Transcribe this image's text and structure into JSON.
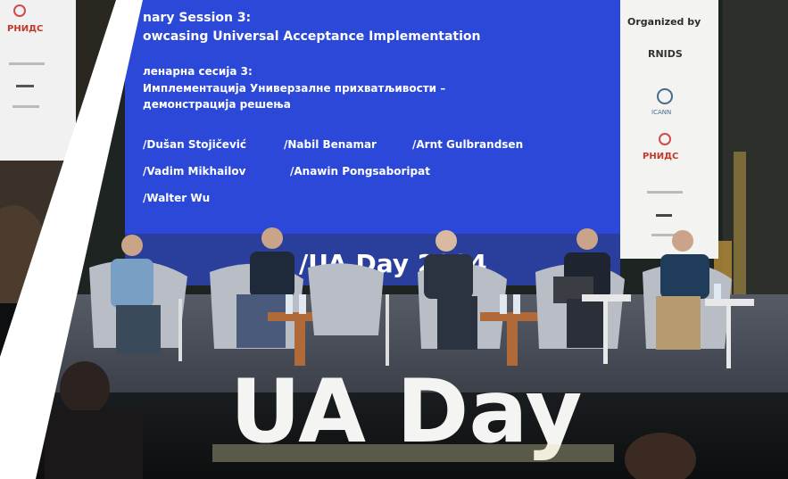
{
  "screen": {
    "headline_en": "nary Session 3:",
    "subtitle_en": "owcasing Universal Acceptance Implementation",
    "headline_sr": "ленарна сесија 3:",
    "subtitle_sr_1": "Имплементација Универзалне прихватљивости –",
    "subtitle_sr_2": "демонстрација решења",
    "speakers_row1": [
      "/Dušan Stojičević",
      "/Nabil Benamar",
      "/Arnt Gulbrandsen"
    ],
    "speakers_row2": [
      "/Vadim Mikhailov",
      "/Anawin Pongsaboripat"
    ],
    "speakers_row3": [
      "/Walter Wu"
    ],
    "banner": "/UA Day 2024"
  },
  "sponsors": {
    "organized_by": "Organized by",
    "logo_1": "RNIDS",
    "logo_2": "ICANN",
    "logo_3": "PHИДС",
    "left_logo": "PHИДС"
  },
  "stage_sign": "UA Day",
  "colors": {
    "screen_blue": "#2b48d8",
    "stage_floor": "#4a4f5c",
    "backdrop": "#1d2422",
    "chair": "#b8bdc6",
    "table": "#b06a3a"
  }
}
